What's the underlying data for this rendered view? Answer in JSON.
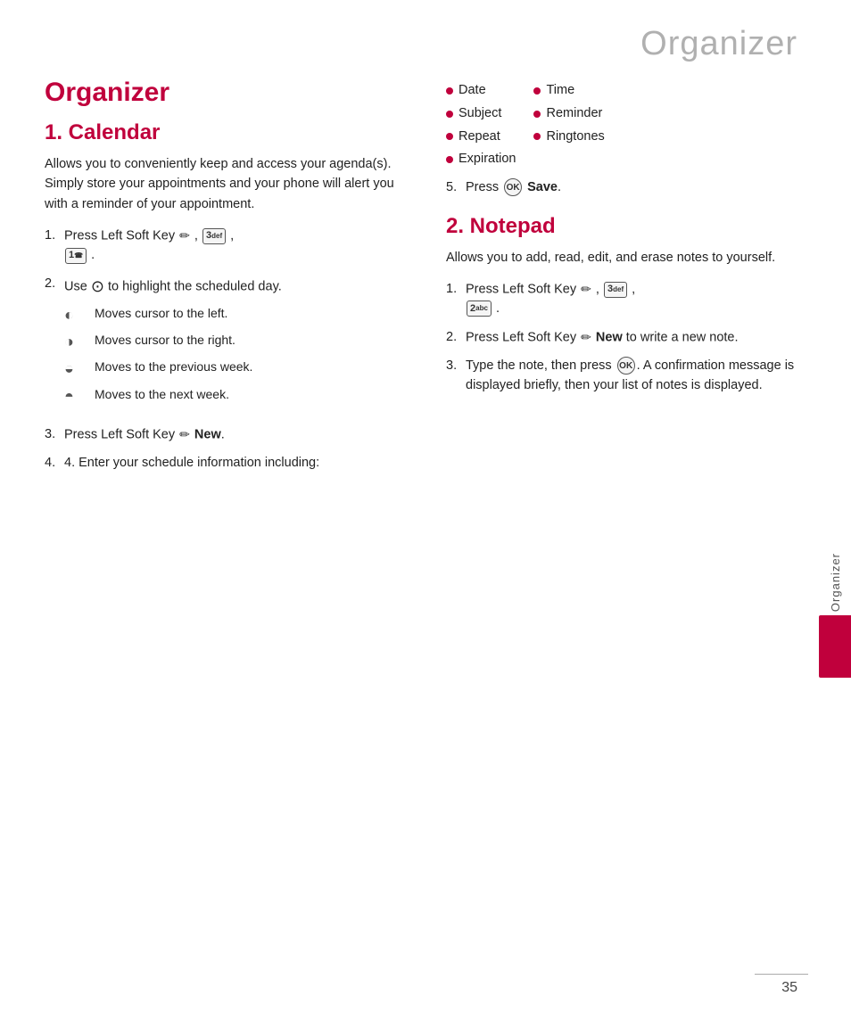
{
  "header": {
    "title": "Organizer",
    "page_number": "35"
  },
  "side_tab": {
    "label": "Organizer"
  },
  "left_column": {
    "main_title": "Organizer",
    "section1_title": "1. Calendar",
    "section1_body": "Allows you to conveniently keep and access your agenda(s). Simply store your appointments and your phone will alert you with a reminder of your appointment.",
    "step1_prefix": "1. Press Left Soft Key",
    "step1_keys": [
      "✏",
      "3def",
      "1☎"
    ],
    "step2_prefix": "2. Use",
    "step2_suffix": "to highlight the scheduled day.",
    "nav_items": [
      {
        "icon": "◐",
        "text": "Moves cursor to the left."
      },
      {
        "icon": "◑",
        "text": "Moves cursor to the right."
      },
      {
        "icon": "◒",
        "text": "Moves to the previous week."
      },
      {
        "icon": "◓",
        "text": "Moves to the next week."
      }
    ],
    "step3_prefix": "3. Press Left Soft Key",
    "step3_new": "New",
    "step3_suffix": ".",
    "step4_text": "4. Enter your schedule information including:"
  },
  "right_column": {
    "bullet_col1": [
      "Date",
      "Subject",
      "Repeat",
      "Expiration"
    ],
    "bullet_col2": [
      "Time",
      "Reminder",
      "Ringtones"
    ],
    "step5_prefix": "5. Press",
    "step5_ok": "OK",
    "step5_suffix": "Save.",
    "section2_title": "2. Notepad",
    "section2_body": "Allows you to add, read, edit, and erase notes to yourself.",
    "notepad_step1_prefix": "1. Press Left Soft Key",
    "notepad_step1_keys": [
      "✏",
      "3def",
      "2abc"
    ],
    "notepad_step2_prefix": "2. Press Left Soft Key",
    "notepad_step2_new": "New",
    "notepad_step2_suffix": "to write a new note.",
    "notepad_step3_text": "3. Type the note, then press",
    "notepad_step3_suffix": ". A confirmation message is displayed briefly, then your list of notes is displayed."
  }
}
